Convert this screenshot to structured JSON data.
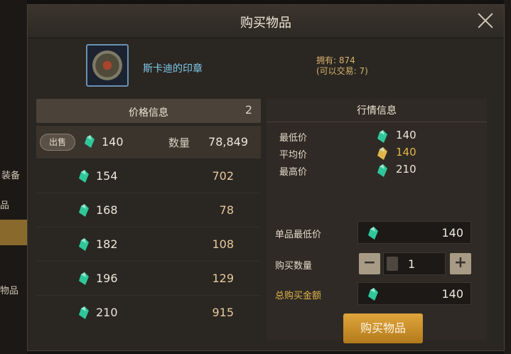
{
  "dialog": {
    "title": "购买物品",
    "close": "close"
  },
  "item": {
    "name": "斯卡迪的印章",
    "owned": "拥有: 874",
    "tradable": "(可以交易: 7)"
  },
  "price_info": {
    "header": "价格信息",
    "count": "2",
    "sell_label": "出售",
    "qty_label": "数量",
    "rows": [
      {
        "price": "140",
        "qty": "78,849"
      },
      {
        "price": "154",
        "qty": "702"
      },
      {
        "price": "168",
        "qty": "78"
      },
      {
        "price": "182",
        "qty": "108"
      },
      {
        "price": "196",
        "qty": "129"
      },
      {
        "price": "210",
        "qty": "915"
      }
    ]
  },
  "market_info": {
    "header": "行情信息",
    "lowest_label": "最低价",
    "lowest": "140",
    "avg_label": "平均价",
    "avg": "140",
    "highest_label": "最高价",
    "highest": "210"
  },
  "purchase": {
    "unit_min_label": "单品最低价",
    "unit_min": "140",
    "qty_label": "购买数量",
    "qty": "1",
    "total_label": "总购买金额",
    "total": "140",
    "buy_button": "购买物品"
  },
  "background_menu": [
    "装备",
    "品",
    "物品"
  ],
  "colors": {
    "gem": "#2fc79a",
    "gold_text": "#e0b54a",
    "accent_button": "#d39a30",
    "item_name": "#7ecae8"
  }
}
